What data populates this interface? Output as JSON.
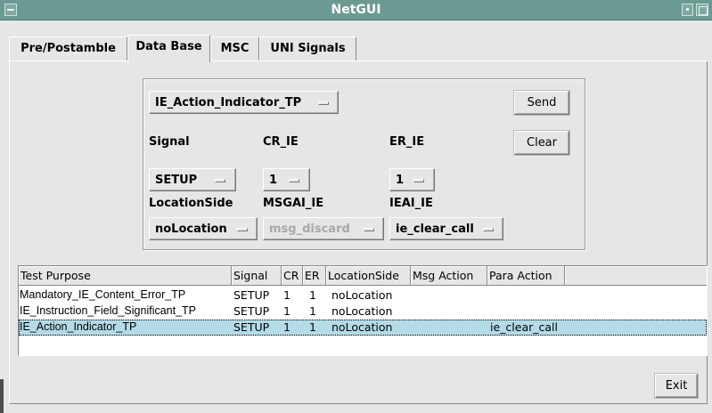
{
  "window": {
    "title": "NetGUI"
  },
  "tabs": [
    {
      "label": "Pre/Postamble",
      "active": false
    },
    {
      "label": "Data Base",
      "active": true
    },
    {
      "label": "MSC",
      "active": false
    },
    {
      "label": "UNI Signals",
      "active": false
    }
  ],
  "form": {
    "test_purpose_select": "IE_Action_Indicator_TP",
    "labels": {
      "signal": "Signal",
      "cr_ie": "CR_IE",
      "er_ie": "ER_IE",
      "location_side": "LocationSide",
      "msgai_ie": "MSGAI_IE",
      "ieai_ie": "IEAI_IE"
    },
    "values": {
      "signal": "SETUP",
      "cr_ie": "1",
      "er_ie": "1",
      "location_side": "noLocation",
      "msgai_ie": "msg_discard",
      "ieai_ie": "ie_clear_call"
    },
    "buttons": {
      "send": "Send",
      "clear": "Clear"
    }
  },
  "table": {
    "columns": [
      "Test Purpose",
      "Signal",
      "CR",
      "ER",
      "LocationSide",
      "Msg Action",
      "Para Action"
    ],
    "rows": [
      {
        "test_purpose": "Mandatory_IE_Content_Error_TP",
        "signal": "SETUP",
        "cr": "1",
        "er": "1",
        "location_side": "noLocation",
        "msg_action": "",
        "para_action": "",
        "selected": false
      },
      {
        "test_purpose": "IE_Instruction_Field_Significant_TP",
        "signal": "SETUP",
        "cr": "1",
        "er": "1",
        "location_side": "noLocation",
        "msg_action": "",
        "para_action": "",
        "selected": false
      },
      {
        "test_purpose": "IE_Action_Indicator_TP",
        "signal": "SETUP",
        "cr": "1",
        "er": "1",
        "location_side": "noLocation",
        "msg_action": "",
        "para_action": "ie_clear_call",
        "selected": true
      }
    ]
  },
  "footer": {
    "exit_label": "Exit"
  },
  "colors": {
    "titlebar": "#6b9a92",
    "selected_row": "#b4dce8",
    "background": "#e6e6e6"
  }
}
